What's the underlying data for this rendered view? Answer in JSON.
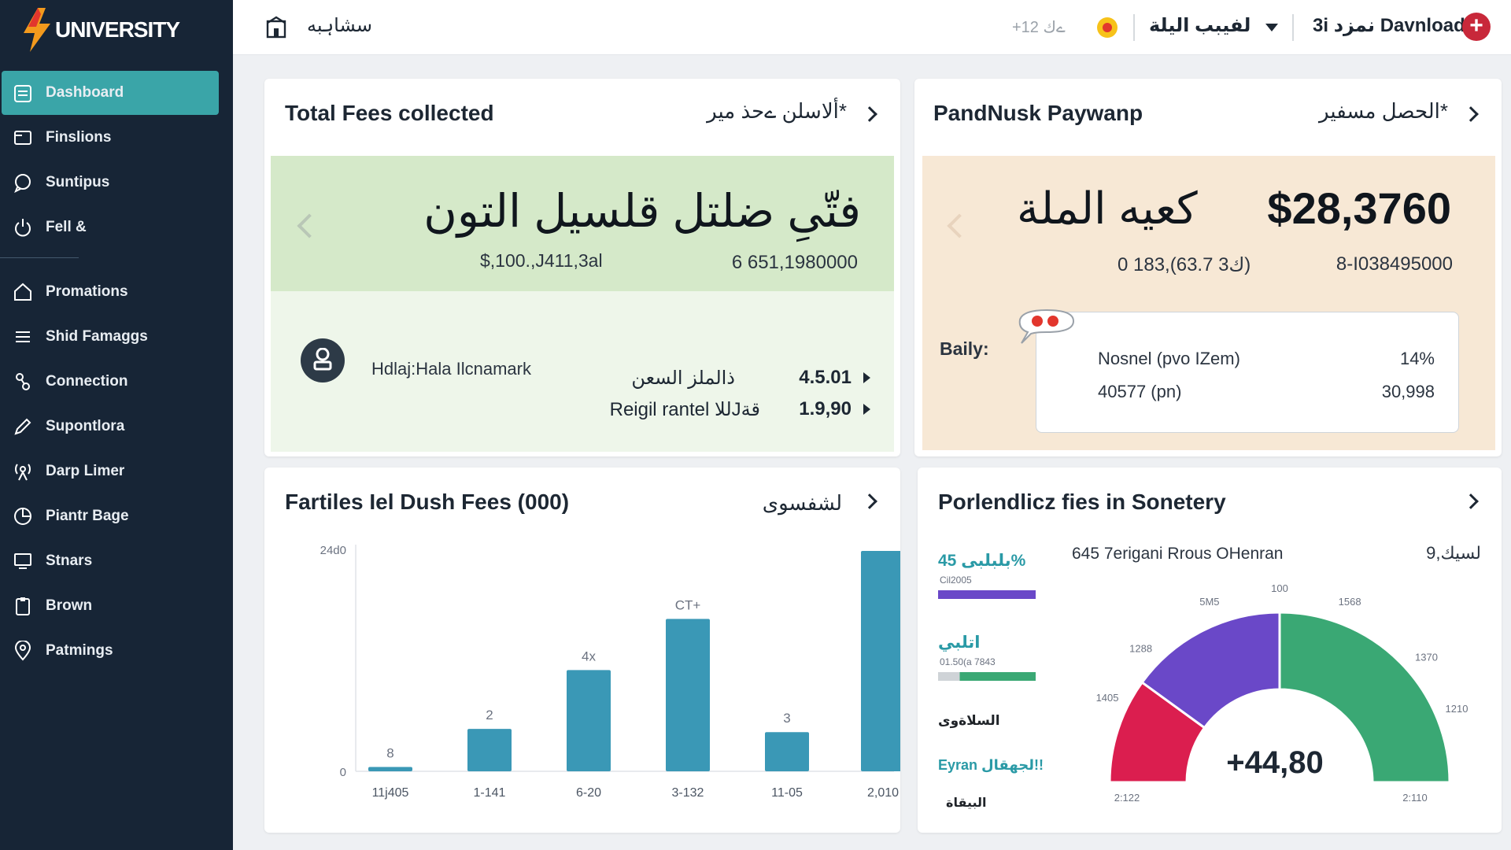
{
  "sidebar": {
    "logo": "UNIVERSITY",
    "items": [
      {
        "label": "Dashboard",
        "icon": "dashboard-icon",
        "active": true
      },
      {
        "label": "Finslions",
        "icon": "finance-icon"
      },
      {
        "label": "Suntipus",
        "icon": "chat-icon"
      },
      {
        "label": "Fell &",
        "icon": "power-icon"
      },
      {
        "label": "Promations",
        "icon": "home-icon"
      },
      {
        "label": "Shid Famaggs",
        "icon": "list-icon"
      },
      {
        "label": "Connection",
        "icon": "connection-icon"
      },
      {
        "label": "Supontlora",
        "icon": "pen-icon"
      },
      {
        "label": "Darp Limer",
        "icon": "signal-icon"
      },
      {
        "label": "Piantr Bage",
        "icon": "pie-icon"
      },
      {
        "label": "Stnars",
        "icon": "monitor-icon"
      },
      {
        "label": "Brown",
        "icon": "clipboard-icon"
      },
      {
        "label": "Patmings",
        "icon": "location-icon"
      }
    ]
  },
  "topbar": {
    "left_label": "سشاہبه",
    "count": "+12 ےك",
    "language": "لفيبب اليلة",
    "download": "3i نمزد Davnload"
  },
  "card1": {
    "title": "Total Fees collected",
    "subtitle": "ألاسلن ےحذ میر*",
    "big_text": "فتّیِ ضلتل قلسیل التون",
    "value_a": "$,100.,J411,3al",
    "value_b": "6 651,1980000",
    "user": "Hdlaj:Hala Ilcnamark",
    "rows": [
      {
        "label": "ذالملز السعن",
        "value": "4.5.01"
      },
      {
        "label": "Reigil rantel للاJقة",
        "value": "1.9,90"
      }
    ]
  },
  "card2": {
    "title": "PandNusk Paywanp",
    "subtitle": "الحصل مسفیر*",
    "arabic": "كعيه الملة",
    "amount": "$28,3760",
    "value_a": "0 183,(63.7 3ك)",
    "value_b": "8-I038495000",
    "daily_label": "Baily:",
    "box_rows": [
      {
        "label": "Nosnel (pvo IZem)",
        "value": "14%"
      },
      {
        "label": "40577 (pn)",
        "value": "30,998"
      }
    ]
  },
  "card3": {
    "title": "Fartiles Iel Dush Fees (000)",
    "subtitle": "لشفسوی"
  },
  "card4": {
    "title": "Porlendlicz fies in Sonetery",
    "head_left": "645 7erigani Rrous OHenran",
    "head_right": "9,لسیك",
    "legend": [
      {
        "label": "بلبلبی 45%",
        "sub": "Cil2005",
        "color": "#6a48c8"
      },
      {
        "label": "اتلبي",
        "sub": "01.50(a 7843",
        "color": "#3aa874"
      },
      {
        "label": "السلاةوی",
        "sub": "",
        "color": "#1d2733"
      },
      {
        "label": "Eyran لجهقال!!",
        "sub": "",
        "color": "#2a9aa6"
      },
      {
        "label": "البیقاة",
        "sub": "",
        "color": "#1d2733"
      }
    ],
    "gauge_value": "+44,80",
    "gauge_ticks": [
      "2:122",
      "1405",
      "1288",
      "5M5",
      "100",
      "1568",
      "1370",
      "1210",
      "2:110"
    ]
  },
  "chart_data": {
    "type": "bar",
    "categories": [
      "11j405",
      "1-141",
      "6-20",
      "3-132",
      "11-05",
      "2,010"
    ],
    "values": [
      8,
      78,
      186,
      280,
      72,
      405
    ],
    "data_labels": [
      "8",
      "2",
      "4x",
      "CT+",
      "3",
      ""
    ],
    "ytick_labels": [
      "0",
      "24d0"
    ],
    "ylim": [
      0,
      405
    ],
    "title": "Fartiles Iel Dush Fees (000)",
    "color": "#3a98b6"
  },
  "gauge_data": {
    "type": "gauge",
    "segments": [
      {
        "color": "#db1e4f",
        "fraction": 0.2
      },
      {
        "color": "#6a48c8",
        "fraction": 0.3
      },
      {
        "color": "#3aa874",
        "fraction": 0.5
      }
    ]
  }
}
